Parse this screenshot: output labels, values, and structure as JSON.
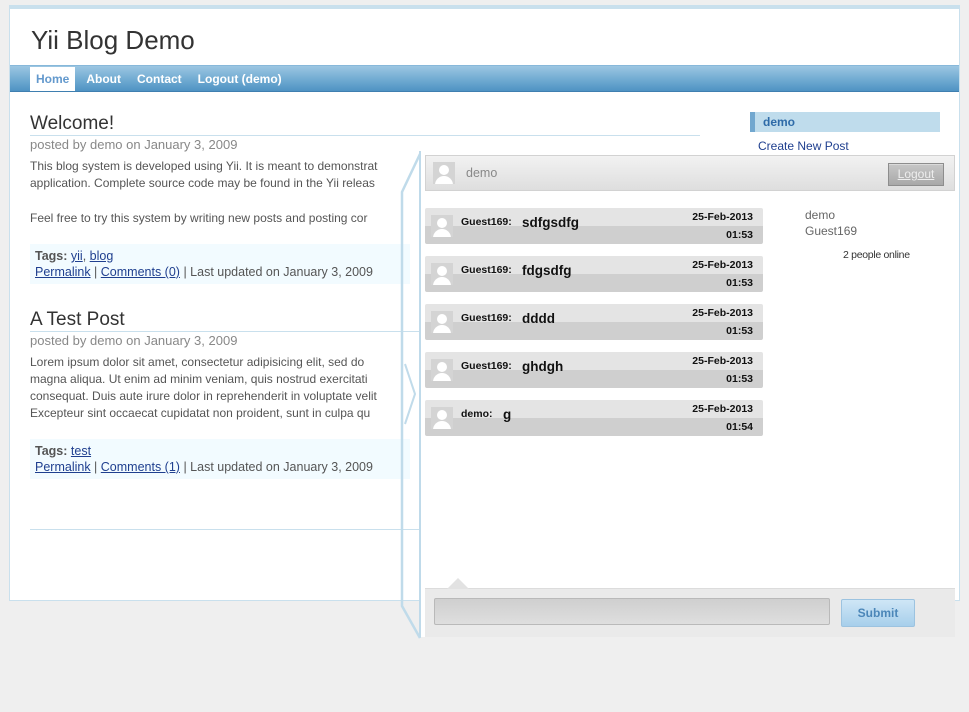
{
  "site": {
    "title": "Yii Blog Demo"
  },
  "menu": [
    {
      "label": "Home",
      "active": true
    },
    {
      "label": "About"
    },
    {
      "label": "Contact"
    },
    {
      "label": "Logout (demo)"
    }
  ],
  "posts": [
    {
      "title": "Welcome!",
      "meta": "posted by demo on January 3, 2009",
      "paragraphs": [
        "This blog system is developed using Yii. It is meant to demonstrat",
        "application. Complete source code may be found in the Yii releas",
        "Feel free to try this system by writing new posts and posting cor"
      ],
      "tags_label": "Tags:",
      "tags": [
        "yii",
        "blog"
      ],
      "permalink": "Permalink",
      "comments": "Comments (0)",
      "updated": "Last updated on January 3, 2009"
    },
    {
      "title": "A Test Post",
      "meta": "posted by demo on January 3, 2009",
      "paragraphs": [
        "Lorem ipsum dolor sit amet, consectetur adipisicing elit, sed do",
        "magna aliqua. Ut enim ad minim veniam, quis nostrud exercitati",
        "consequat. Duis aute irure dolor in reprehenderit in voluptate velit",
        "Excepteur sint occaecat cupidatat non proident, sunt in culpa qu"
      ],
      "tags_label": "Tags:",
      "tags": [
        "test"
      ],
      "permalink": "Permalink",
      "comments": "Comments (1)",
      "updated": "Last updated on January 3, 2009"
    }
  ],
  "sidebar": {
    "title": "demo",
    "link": "Create New Post"
  },
  "chat": {
    "user": "demo",
    "logout_label": "Logout",
    "messages": [
      {
        "author": "Guest169:",
        "text": "sdfgsdfg",
        "date": "25-Feb-2013",
        "time": "01:53"
      },
      {
        "author": "Guest169:",
        "text": "fdgsdfg",
        "date": "25-Feb-2013",
        "time": "01:53"
      },
      {
        "author": "Guest169:",
        "text": "dddd",
        "date": "25-Feb-2013",
        "time": "01:53"
      },
      {
        "author": "Guest169:",
        "text": "ghdgh",
        "date": "25-Feb-2013",
        "time": "01:53"
      },
      {
        "author": "demo:",
        "text": "g",
        "date": "25-Feb-2013",
        "time": "01:54"
      }
    ],
    "online_users": [
      "demo",
      "Guest169"
    ],
    "online_count": "2 people online",
    "input_value": "",
    "submit_label": "Submit"
  },
  "icons": {
    "avatar": "user-avatar-icon"
  }
}
